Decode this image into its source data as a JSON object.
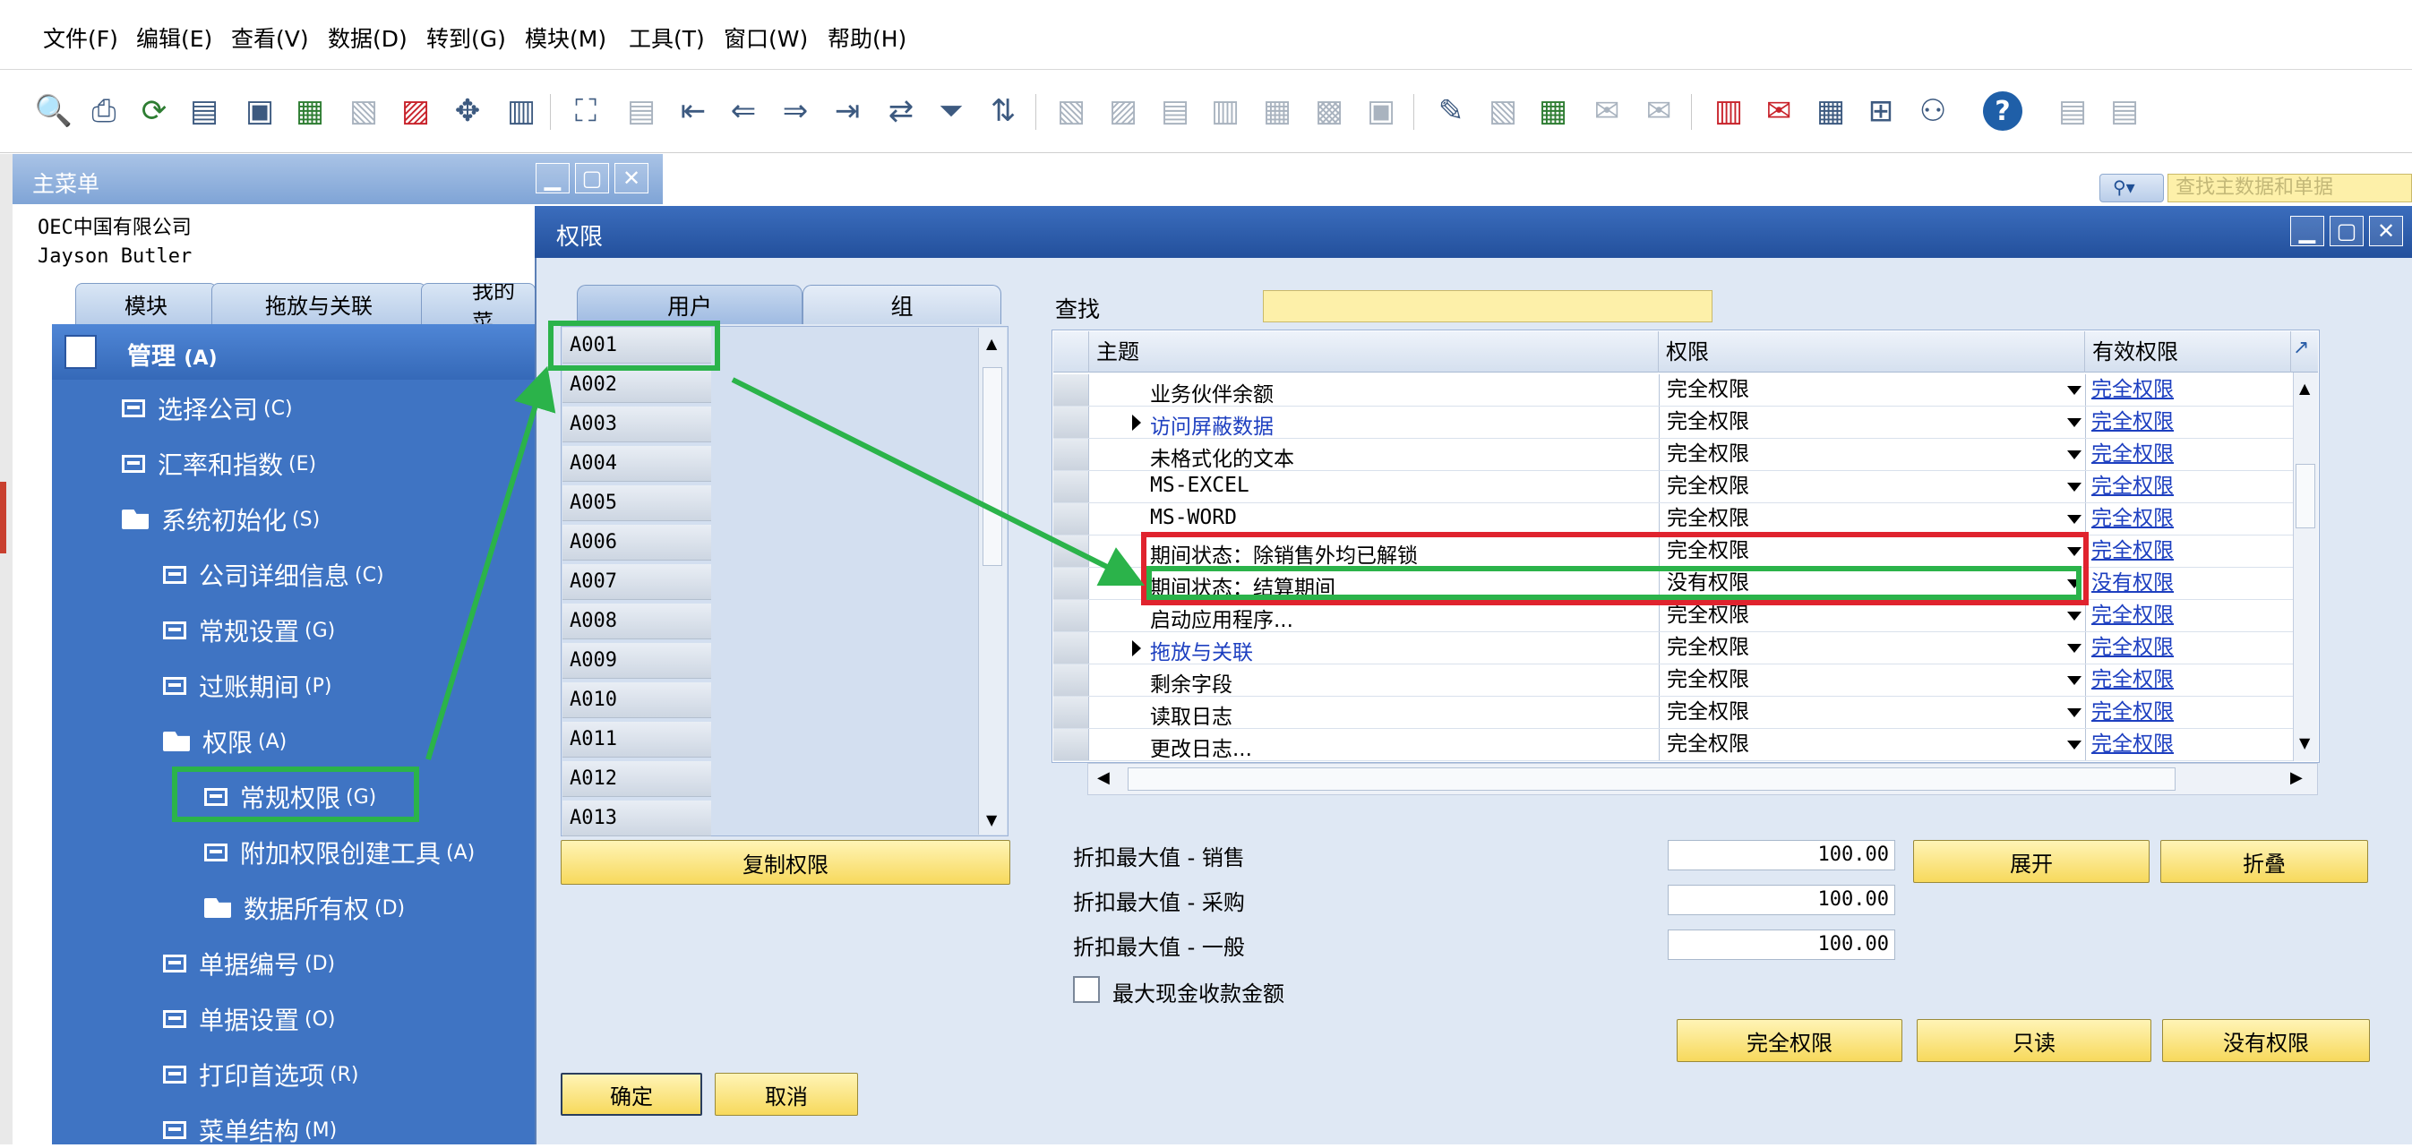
{
  "menubar": {
    "items": [
      "文件(F)",
      "编辑(E)",
      "查看(V)",
      "数据(D)",
      "转到(G)",
      "模块(M)",
      "工具(T)",
      "窗口(W)",
      "帮助(H)"
    ]
  },
  "toolbar": {
    "search_placeholder": "查找主数据和单据"
  },
  "main_menu": {
    "title": "主菜单",
    "company": "OEC中国有限公司",
    "user": "Jayson Butler",
    "tabs": [
      "模块",
      "拖放与关联",
      "我的菜"
    ],
    "section": {
      "label": "管理",
      "accel": "(A)"
    },
    "items": [
      {
        "label": "选择公司",
        "accel": "(C)"
      },
      {
        "label": "汇率和指数",
        "accel": "(E)"
      },
      {
        "label": "系统初始化",
        "accel": "(S)"
      },
      {
        "label": "公司详细信息",
        "accel": "(C)"
      },
      {
        "label": "常规设置",
        "accel": "(G)"
      },
      {
        "label": "过账期间",
        "accel": "(P)"
      },
      {
        "label": "权限",
        "accel": "(A)"
      },
      {
        "label": "常规权限",
        "accel": "(G)"
      },
      {
        "label": "附加权限创建工具",
        "accel": "(A)"
      },
      {
        "label": "数据所有权",
        "accel": "(D)"
      },
      {
        "label": "单据编号",
        "accel": "(D)"
      },
      {
        "label": "单据设置",
        "accel": "(O)"
      },
      {
        "label": "打印首选项",
        "accel": "(R)"
      },
      {
        "label": "菜单结构",
        "accel": "(M)"
      }
    ]
  },
  "dialog": {
    "title": "权限",
    "tabs": {
      "users": "用户",
      "groups": "组"
    },
    "users": [
      "A001",
      "A002",
      "A003",
      "A004",
      "A005",
      "A006",
      "A007",
      "A008",
      "A009",
      "A010",
      "A011",
      "A012",
      "A013"
    ],
    "copy_button": "复制权限",
    "find_label": "查找",
    "find_value": "",
    "columns": {
      "subject": "主题",
      "permission": "权限",
      "effective": "有效权限"
    },
    "rows": [
      {
        "subject": "业务伙伴余额",
        "permission": "完全权限",
        "effective": "完全权限"
      },
      {
        "subject": "访问屏蔽数据",
        "permission": "完全权限",
        "effective": "完全权限"
      },
      {
        "subject": "未格式化的文本",
        "permission": "完全权限",
        "effective": "完全权限"
      },
      {
        "subject": "MS-EXCEL",
        "permission": "完全权限",
        "effective": "完全权限"
      },
      {
        "subject": "MS-WORD",
        "permission": "完全权限",
        "effective": "完全权限"
      },
      {
        "subject": "期间状态：除销售外均已解锁",
        "permission": "完全权限",
        "effective": "完全权限"
      },
      {
        "subject": "期间状态：结算期间",
        "permission": "没有权限",
        "effective": "没有权限"
      },
      {
        "subject": "启动应用程序...",
        "permission": "完全权限",
        "effective": "完全权限"
      },
      {
        "subject": "拖放与关联",
        "permission": "完全权限",
        "effective": "完全权限"
      },
      {
        "subject": "剩余字段",
        "permission": "完全权限",
        "effective": "完全权限"
      },
      {
        "subject": "读取日志",
        "permission": "完全权限",
        "effective": "完全权限"
      },
      {
        "subject": "更改日志...",
        "permission": "完全权限",
        "effective": "完全权限"
      }
    ],
    "expand_button": "展开",
    "collapse_button": "折叠",
    "fields": [
      {
        "label": "折扣最大值 - 销售",
        "value": "100.00"
      },
      {
        "label": "折扣最大值 - 采购",
        "value": "100.00"
      },
      {
        "label": "折扣最大值 - 一般",
        "value": "100.00"
      }
    ],
    "max_cash_label": "最大现金收款金额",
    "full_button": "完全权限",
    "readonly_button": "只读",
    "none_button": "没有权限",
    "ok_button": "确定",
    "cancel_button": "取消"
  },
  "colors": {
    "annotation_green": "#2bb34a",
    "annotation_red": "#e0232e",
    "tree_blue": "#3f74c3",
    "button_yellow": "#f7d95c"
  }
}
